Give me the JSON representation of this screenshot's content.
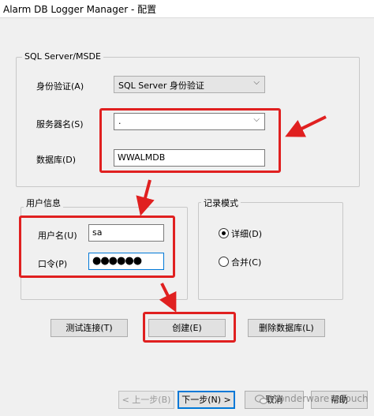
{
  "window": {
    "title": "Alarm DB Logger Manager - 配置"
  },
  "sql_group": {
    "legend": "SQL Server/MSDE",
    "auth_label": "身份验证(A)",
    "auth_value": "SQL Server 身份验证",
    "server_label": "服务器名(S)",
    "server_value": ".",
    "database_label": "数据库(D)",
    "database_value": "WWALMDB"
  },
  "user_group": {
    "legend": "用户信息",
    "username_label": "用户名(U)",
    "username_value": "sa",
    "password_label": "口令(P)",
    "password_value": "●●●●●●"
  },
  "log_mode_group": {
    "legend": "记录模式",
    "options": [
      {
        "label": "详细(D)",
        "selected": true
      },
      {
        "label": "合并(C)",
        "selected": false
      }
    ]
  },
  "actions": {
    "test_connection": "测试连接(T)",
    "create": "创建(E)",
    "delete_db": "删除数据库(L)"
  },
  "wizard": {
    "back": "< 上一步(B)",
    "next": "下一步(N) >",
    "cancel": "取消",
    "help": "帮助"
  },
  "watermark": {
    "text": "Wonderware InTouch"
  },
  "colors": {
    "highlight": "#e02020",
    "focus": "#0078d7",
    "dialog_bg": "#f0f0f0"
  }
}
